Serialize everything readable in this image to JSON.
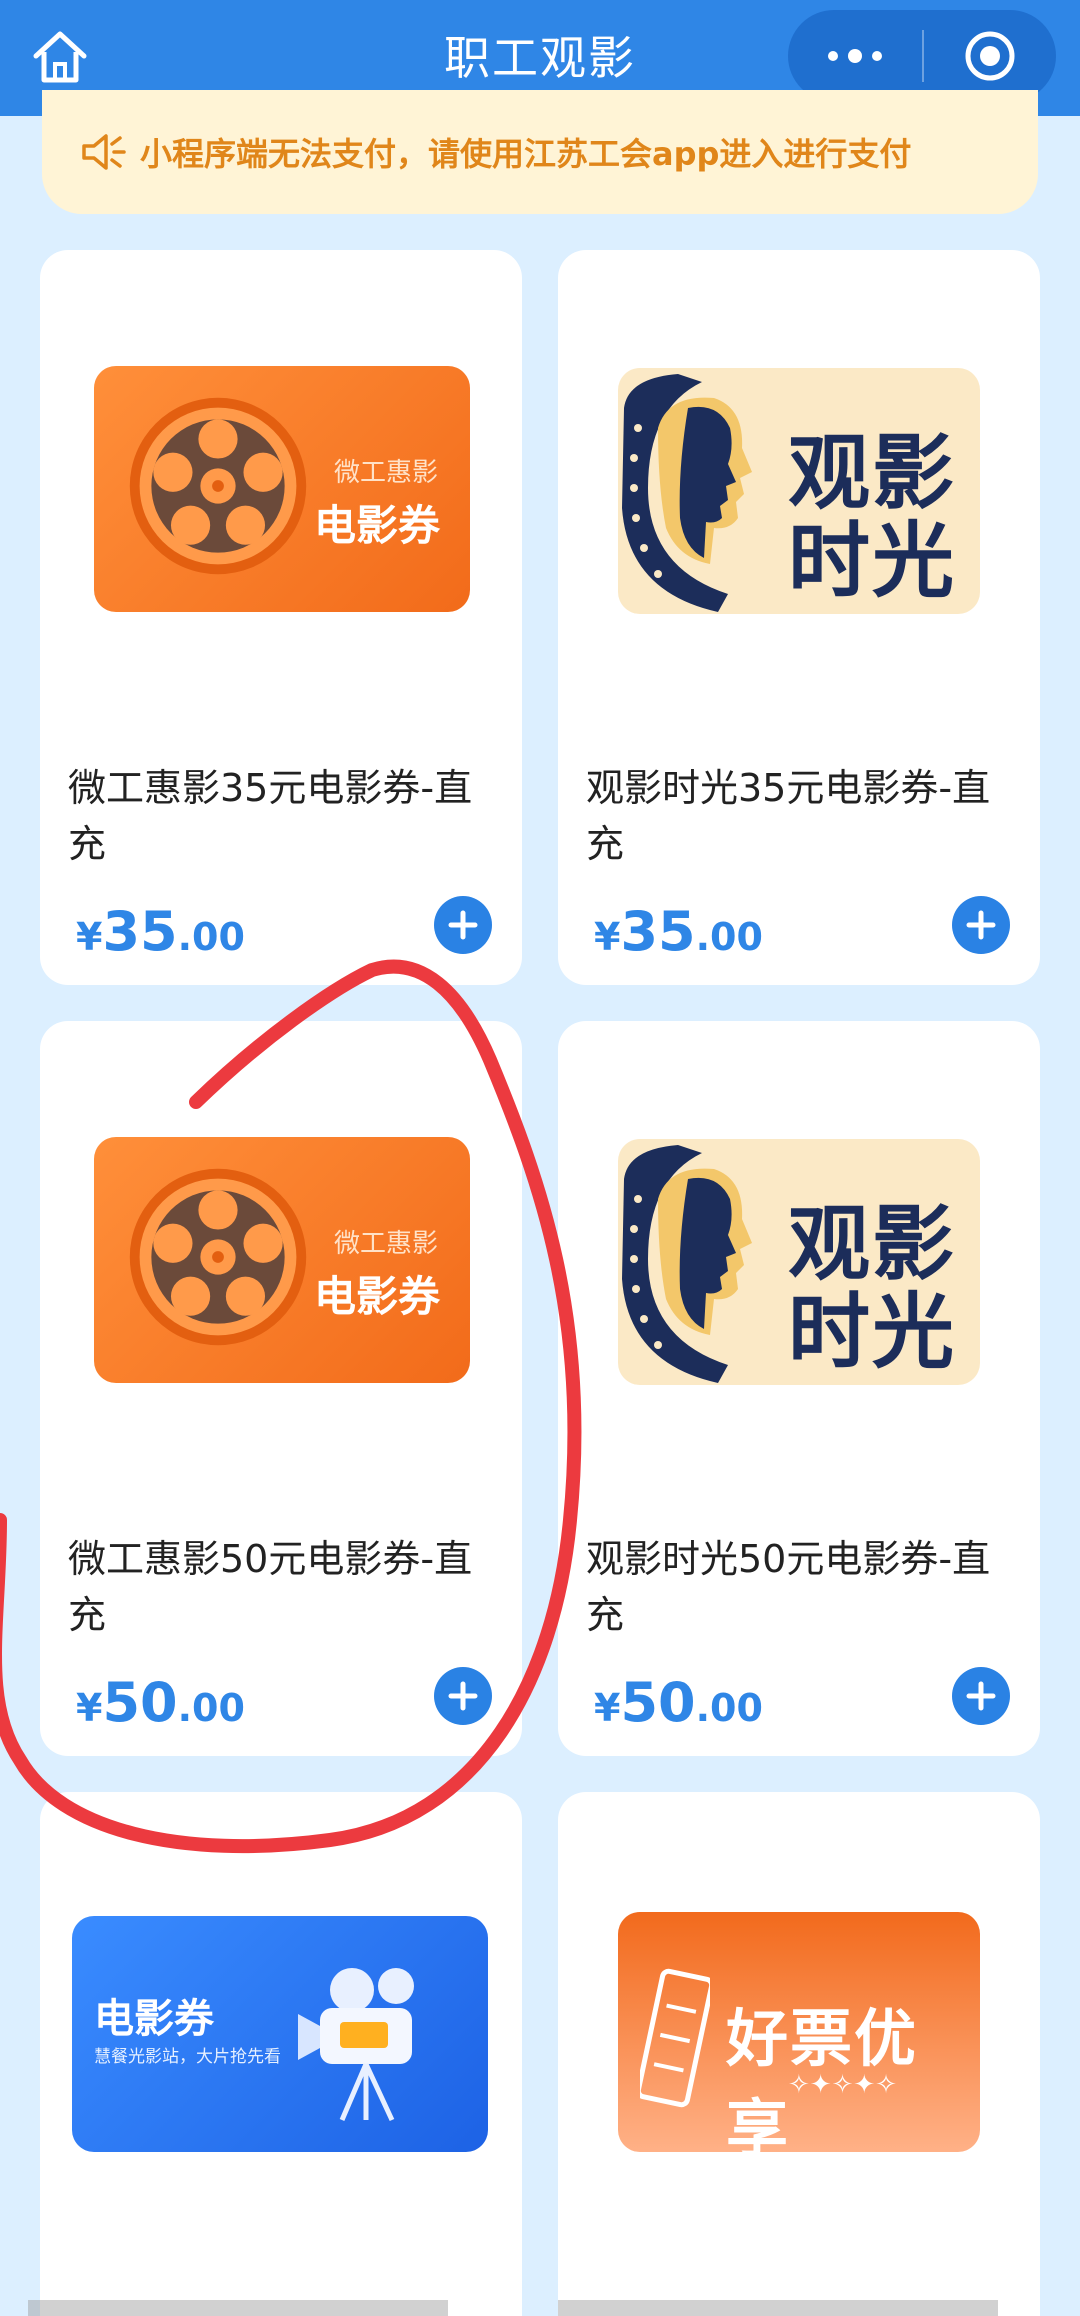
{
  "header": {
    "title": "职工观影"
  },
  "notice": {
    "text": "小程序端无法支付，请使用江苏工会app进入进行支付"
  },
  "products": [
    {
      "name": "微工惠影35元电影券-直充",
      "price_symbol": "¥",
      "price_int": "35",
      "price_dec": ".00",
      "art": {
        "sub": "微工惠影",
        "main": "电影券"
      }
    },
    {
      "name": "观影时光35元电影券-直充",
      "price_symbol": "¥",
      "price_int": "35",
      "price_dec": ".00",
      "art": {
        "line1": "观影",
        "line2": "时光"
      }
    },
    {
      "name": "微工惠影50元电影券-直充",
      "price_symbol": "¥",
      "price_int": "50",
      "price_dec": ".00",
      "art": {
        "sub": "微工惠影",
        "main": "电影券"
      }
    },
    {
      "name": "观影时光50元电影券-直充",
      "price_symbol": "¥",
      "price_int": "50",
      "price_dec": ".00",
      "art": {
        "line1": "观影",
        "line2": "时光"
      }
    },
    {
      "art": {
        "title": "电影券",
        "subtitle": "慧餐光影站，大片抢先看"
      }
    },
    {
      "art": {
        "title": "好票优享",
        "subtitle": "✧✦✧✦✧"
      }
    }
  ],
  "colors": {
    "header_bg": "#2f86e6",
    "price": "#2f86e6",
    "notice_text": "#e0861a",
    "annotation": "#ec3a3f"
  }
}
